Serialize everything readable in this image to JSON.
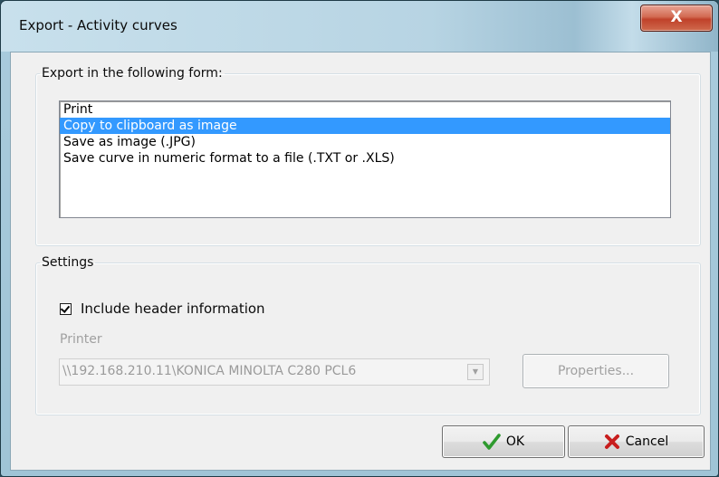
{
  "window": {
    "title": "Export - Activity curves",
    "close_glyph": "X"
  },
  "export_group": {
    "legend": "Export in the following form:",
    "options": [
      {
        "label": "Print",
        "selected": false
      },
      {
        "label": "Copy to clipboard as image",
        "selected": true
      },
      {
        "label": "Save as image (.JPG)",
        "selected": false
      },
      {
        "label": "Save curve in numeric format to a file (.TXT or .XLS)",
        "selected": false
      }
    ]
  },
  "settings_group": {
    "legend": "Settings",
    "include_header": {
      "label": "Include header information",
      "checked": true
    },
    "printer_label": "Printer",
    "printer_value": "\\\\192.168.210.11\\KONICA MINOLTA C280 PCL6",
    "properties_button": "Properties..."
  },
  "footer": {
    "ok_label": "OK",
    "cancel_label": "Cancel"
  },
  "icons": {
    "ok": "green-checkmark-icon",
    "cancel": "red-x-icon",
    "combo_arrow": "chevron-down-icon"
  },
  "colors": {
    "selection": "#3399ff",
    "ok_check": "#2e9a2e",
    "cancel_x": "#c81e1e",
    "close_button": "#c0412a"
  }
}
